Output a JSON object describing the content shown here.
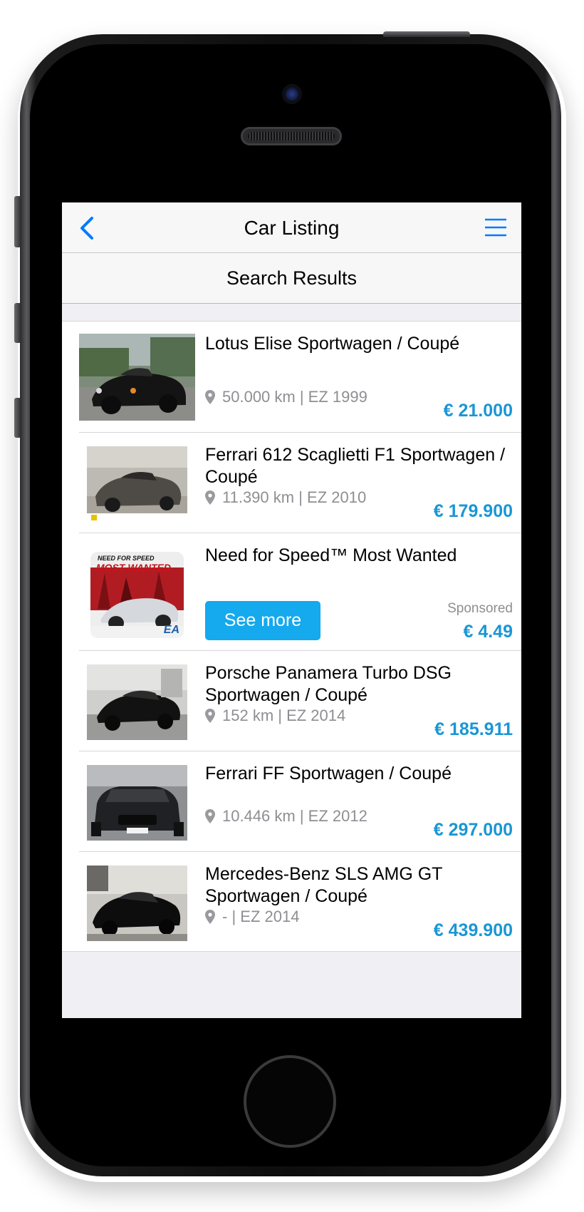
{
  "navbar": {
    "title": "Car Listing",
    "back_icon": "chevron-left-icon",
    "menu_icon": "hamburger-menu-icon"
  },
  "subheader": {
    "title": "Search Results"
  },
  "listings": [
    {
      "title": "Lotus Elise Sportwagen / Coupé",
      "meta": "50.000 km | EZ 1999",
      "price": "€ 21.000"
    },
    {
      "title": "Ferrari 612 Scaglietti F1 Sportwagen / Coupé",
      "meta": "11.390 km | EZ 2010",
      "price": "€ 179.900"
    },
    {
      "title": "Need for Speed™ Most Wanted",
      "button": "See more",
      "sponsored": "Sponsored",
      "price": "€ 4.49",
      "app_icon_text": "NEED FOR SPEED",
      "app_icon_subtext": "MOST WANTED",
      "app_icon_badge": "EA"
    },
    {
      "title": "Porsche Panamera Turbo DSG Sportwagen / Coupé",
      "meta": "152 km | EZ 2014",
      "price": "€ 185.911"
    },
    {
      "title": "Ferrari FF Sportwagen / Coupé",
      "meta": "10.446 km | EZ 2012",
      "price": "€ 297.000"
    },
    {
      "title": "Mercedes-Benz SLS AMG GT Sportwagen / Coupé",
      "meta": "- | EZ 2014",
      "price": "€ 439.900"
    }
  ],
  "colors": {
    "accent": "#007aff",
    "price": "#1a96d4",
    "button": "#15a9ee",
    "meta": "#8e8e93",
    "background": "#efeff4"
  }
}
